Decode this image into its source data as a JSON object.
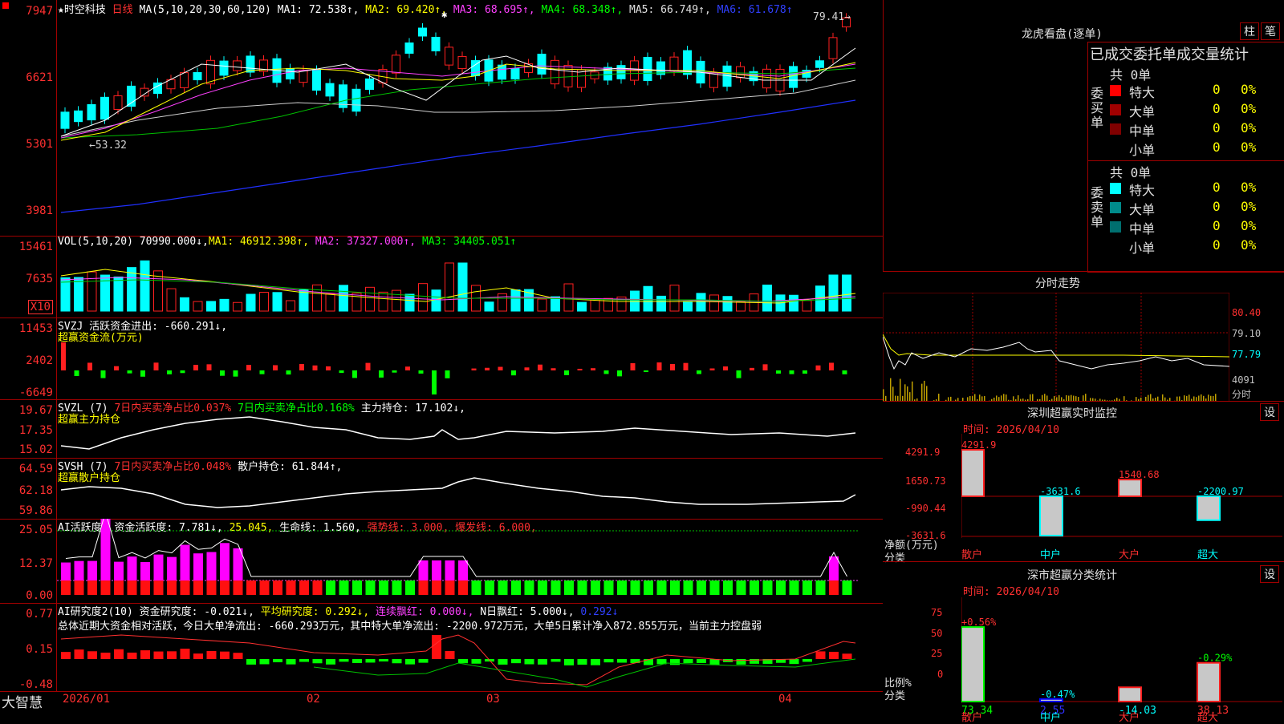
{
  "stock": {
    "star": "★",
    "name": "时空科技",
    "period": "日线"
  },
  "main": {
    "ma_label": "MA(5,10,20,30,60,120)",
    "ma1": "MA1: 72.538↑,",
    "ma2": "MA2: 69.420↑,",
    "ma3": "MA3: 68.695↑,",
    "ma4": "MA4: 68.348↑,",
    "ma5": "MA5: 66.749↑,",
    "ma6": "MA6: 61.678↑",
    "y": [
      "7947",
      "6621",
      "5301",
      "3981"
    ],
    "low_label": "←53.32",
    "high_label": "79.41→"
  },
  "vol": {
    "label": "VOL(5,10,20)",
    "val": "70990.000↓,",
    "ma1": "MA1: 46912.398↑,",
    "ma2": "MA2: 37327.000↑,",
    "ma3": "MA3: 34405.051↑",
    "y": [
      "15461",
      "7635"
    ],
    "x10": "X10"
  },
  "svzj": {
    "label": "SVZJ  活跃资金进出: -660.291↓,",
    "sub": "超赢资金流(万元)",
    "y": [
      "11453",
      "2402",
      "-6649"
    ]
  },
  "svzl": {
    "label": "SVZL (7)",
    "t1": "7日内买卖净占比0.037%",
    "t2": "7日内买卖净占比0.168%",
    "t3": "主力持仓: 17.102↓,",
    "sub": "超赢主力持仓",
    "y": [
      "19.67",
      "17.35",
      "15.02"
    ]
  },
  "svsh": {
    "label": "SVSH (7)",
    "t1": "7日内买卖净占比0.048%",
    "t3": "散户持仓: 61.844↑,",
    "sub": "超赢散户持仓",
    "y": [
      "64.59",
      "62.18",
      "59.86"
    ]
  },
  "ai1": {
    "label": "AI活跃度2",
    "a": "资金活跃度: 7.781↓,",
    "b": "25.045,",
    "c": "生命线: 1.560,",
    "d": "强势线: 3.000,",
    "e": "爆发线: 6.000,",
    "y": [
      "25.05",
      "12.37",
      "0.00"
    ]
  },
  "ai2": {
    "label": "AI研究度2(10)",
    "a": "资金研究度: -0.021↓,",
    "b": "平均研究度: 0.292↓,",
    "c": "连续飘红: 0.000↓,",
    "d": "N日飘红: 5.000↓,",
    "e": "0.292↓",
    "summary": "总体近期大资金相对活跃，今日大单净流出: -660.293万元，其中特大单净流出: -2200.972万元，大单5日累计净入872.855万元，当前主力控盘弱",
    "y": [
      "0.77",
      "0.15",
      "-0.48"
    ]
  },
  "xaxis": {
    "logo": "大智慧",
    "labels": [
      "2026/01",
      "02",
      "03",
      "04"
    ]
  },
  "lhb": {
    "title": "龙虎看盘(逐单)",
    "btn1": "柱",
    "btn2": "笔",
    "header": "已成交委托单成交量统计",
    "buy": {
      "side": "委买单",
      "total": "共 0单",
      "rows": [
        {
          "n": "特大",
          "v": "0",
          "p": "0%",
          "c": "#ff0000"
        },
        {
          "n": "大单",
          "v": "0",
          "p": "0%",
          "c": "#a00000"
        },
        {
          "n": "中单",
          "v": "0",
          "p": "0%",
          "c": "#800000"
        },
        {
          "n": "小单",
          "v": "0",
          "p": "0%",
          "c": ""
        }
      ]
    },
    "sell": {
      "side": "委卖单",
      "total": "共 0单",
      "rows": [
        {
          "n": "特大",
          "v": "0",
          "p": "0%",
          "c": "#00ffff"
        },
        {
          "n": "大单",
          "v": "0",
          "p": "0%",
          "c": "#008b8b"
        },
        {
          "n": "中单",
          "v": "0",
          "p": "0%",
          "c": "#006f6f"
        },
        {
          "n": "小单",
          "v": "0",
          "p": "0%",
          "c": ""
        }
      ]
    }
  },
  "fs": {
    "title": "分时走势",
    "y": [
      "80.40",
      "79.10",
      "77.79",
      "4091",
      "分时"
    ]
  },
  "sz1": {
    "title": "深圳超赢实时监控",
    "btn": "设",
    "time": "时间: 2026/04/10",
    "y": [
      "4291.9",
      "1650.73",
      "-990.44",
      "-3631.6"
    ],
    "ylabel": "净额(万元)",
    "xlabel": "分类",
    "cats": [
      "散户",
      "中户",
      "大户",
      "超大"
    ],
    "vals": [
      "4291.9",
      "-3631.6",
      "1540.68",
      "-2200.97"
    ]
  },
  "sz2": {
    "title": "深市超赢分类统计",
    "btn": "设",
    "time": "时间: 2026/04/10",
    "y": [
      "75",
      "50",
      "25",
      "0"
    ],
    "ylabel": "比例%",
    "xlabel": "分类",
    "cats": [
      "散户",
      "中户",
      "大户",
      "超大"
    ],
    "pcts": [
      "+0.56%",
      "-0.47%",
      "",
      "-0.29%"
    ],
    "vals": [
      "73.34",
      "2.55",
      "-14.03",
      "38.13"
    ]
  },
  "chart_data": {
    "type": "bar",
    "title": "深圳超赢实时监控",
    "categories": [
      "散户",
      "中户",
      "大户",
      "超大"
    ],
    "values": [
      4291.9,
      -3631.6,
      1540.68,
      -2200.97
    ],
    "ylabel": "净额(万元)",
    "ylim": [
      -3631.6,
      4291.9
    ]
  }
}
